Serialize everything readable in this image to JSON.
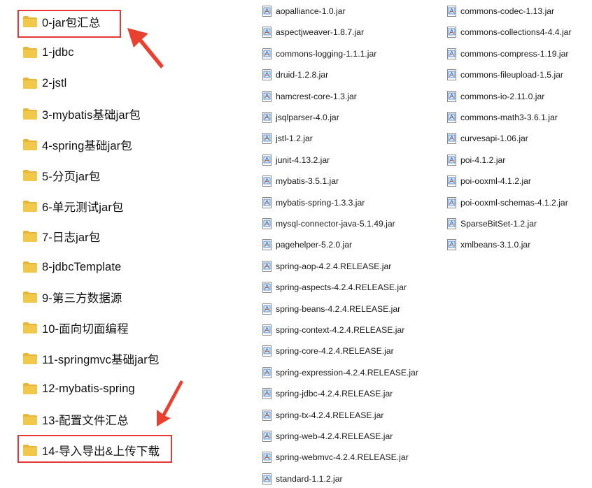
{
  "colors": {
    "folder_body": "#f2c84b",
    "folder_tab": "#e8b535",
    "highlight": "#e53935",
    "arrow": "#e8412f",
    "file_icon_blue": "#3b78c8"
  },
  "folders": [
    {
      "label": "0-jar包汇总",
      "icon": "folder-icon",
      "highlighted": true
    },
    {
      "label": "1-jdbc",
      "icon": "folder-icon"
    },
    {
      "label": "2-jstl",
      "icon": "folder-icon"
    },
    {
      "label": "3-mybatis基础jar包",
      "icon": "folder-icon"
    },
    {
      "label": "4-spring基础jar包",
      "icon": "folder-icon"
    },
    {
      "label": "5-分页jar包",
      "icon": "folder-icon"
    },
    {
      "label": "6-单元测试jar包",
      "icon": "folder-icon"
    },
    {
      "label": "7-日志jar包",
      "icon": "folder-icon"
    },
    {
      "label": "8-jdbcTemplate",
      "icon": "folder-icon"
    },
    {
      "label": "9-第三方数据源",
      "icon": "folder-icon"
    },
    {
      "label": "10-面向切面编程",
      "icon": "folder-icon"
    },
    {
      "label": "11-springmvc基础jar包",
      "icon": "folder-icon"
    },
    {
      "label": "12-mybatis-spring",
      "icon": "folder-icon"
    },
    {
      "label": "13-配置文件汇总",
      "icon": "folder-icon"
    },
    {
      "label": "14-导入导出&上传下载",
      "icon": "folder-icon",
      "highlighted": true
    }
  ],
  "files_col1": [
    "aopalliance-1.0.jar",
    "aspectjweaver-1.8.7.jar",
    "commons-logging-1.1.1.jar",
    "druid-1.2.8.jar",
    "hamcrest-core-1.3.jar",
    "jsqlparser-4.0.jar",
    "jstl-1.2.jar",
    "junit-4.13.2.jar",
    "mybatis-3.5.1.jar",
    "mybatis-spring-1.3.3.jar",
    "mysql-connector-java-5.1.49.jar",
    "pagehelper-5.2.0.jar",
    "spring-aop-4.2.4.RELEASE.jar",
    "spring-aspects-4.2.4.RELEASE.jar",
    "spring-beans-4.2.4.RELEASE.jar",
    "spring-context-4.2.4.RELEASE.jar",
    "spring-core-4.2.4.RELEASE.jar",
    "spring-expression-4.2.4.RELEASE.jar",
    "spring-jdbc-4.2.4.RELEASE.jar",
    "spring-tx-4.2.4.RELEASE.jar",
    "spring-web-4.2.4.RELEASE.jar",
    "spring-webmvc-4.2.4.RELEASE.jar",
    "standard-1.1.2.jar"
  ],
  "files_col2": [
    "commons-codec-1.13.jar",
    "commons-collections4-4.4.jar",
    "commons-compress-1.19.jar",
    "commons-fileupload-1.5.jar",
    "commons-io-2.11.0.jar",
    "commons-math3-3.6.1.jar",
    "curvesapi-1.06.jar",
    "poi-4.1.2.jar",
    "poi-ooxml-4.1.2.jar",
    "poi-ooxml-schemas-4.1.2.jar",
    "SparseBitSet-1.2.jar",
    "xmlbeans-3.1.0.jar"
  ],
  "file_icon": "jar-file-icon"
}
